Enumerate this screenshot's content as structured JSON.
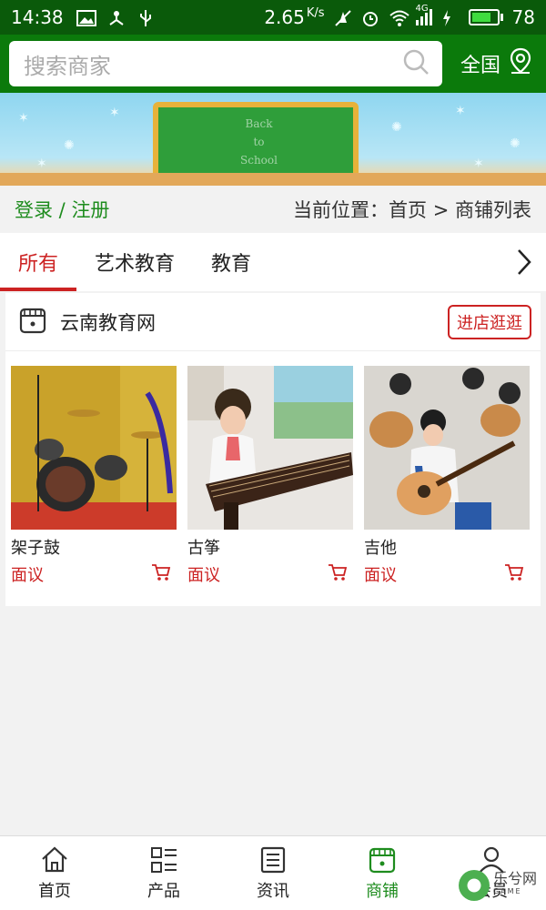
{
  "status_bar": {
    "time": "14:38",
    "speed": "2.65",
    "speed_unit": "K/s",
    "network": "4G",
    "battery": "78",
    "battery_fraction": 0.78
  },
  "search": {
    "placeholder": "搜索商家"
  },
  "region": {
    "label": "全国"
  },
  "banner": {
    "line1": "Back",
    "line2": "to",
    "line3": "School"
  },
  "breadcrumb": {
    "login": "登录",
    "separator": " / ",
    "register": "注册",
    "location": "当前位置：首页 > 商铺列表"
  },
  "tabs": [
    {
      "label": "所有",
      "active": true
    },
    {
      "label": "艺术教育",
      "active": false
    },
    {
      "label": "教育",
      "active": false
    }
  ],
  "shop": {
    "name": "云南教育网",
    "enter_label": "进店逛逛",
    "products": [
      {
        "name": "架子鼓",
        "price": "面议"
      },
      {
        "name": "古筝",
        "price": "面议"
      },
      {
        "name": "吉他",
        "price": "面议"
      }
    ]
  },
  "bottom_nav": [
    {
      "label": "首页",
      "icon": "home-icon"
    },
    {
      "label": "产品",
      "icon": "product-list-icon"
    },
    {
      "label": "资讯",
      "icon": "news-icon"
    },
    {
      "label": "商铺",
      "icon": "shop-icon",
      "active": true
    },
    {
      "label": "会员",
      "icon": "user-icon"
    }
  ],
  "watermark": {
    "text": "乐兮网",
    "sub": "GAME"
  },
  "colors": {
    "header": "#0b7a0b",
    "status_bar": "#0a5a0a",
    "accent_red": "#cc2222",
    "accent_green": "#1e8c1e"
  }
}
